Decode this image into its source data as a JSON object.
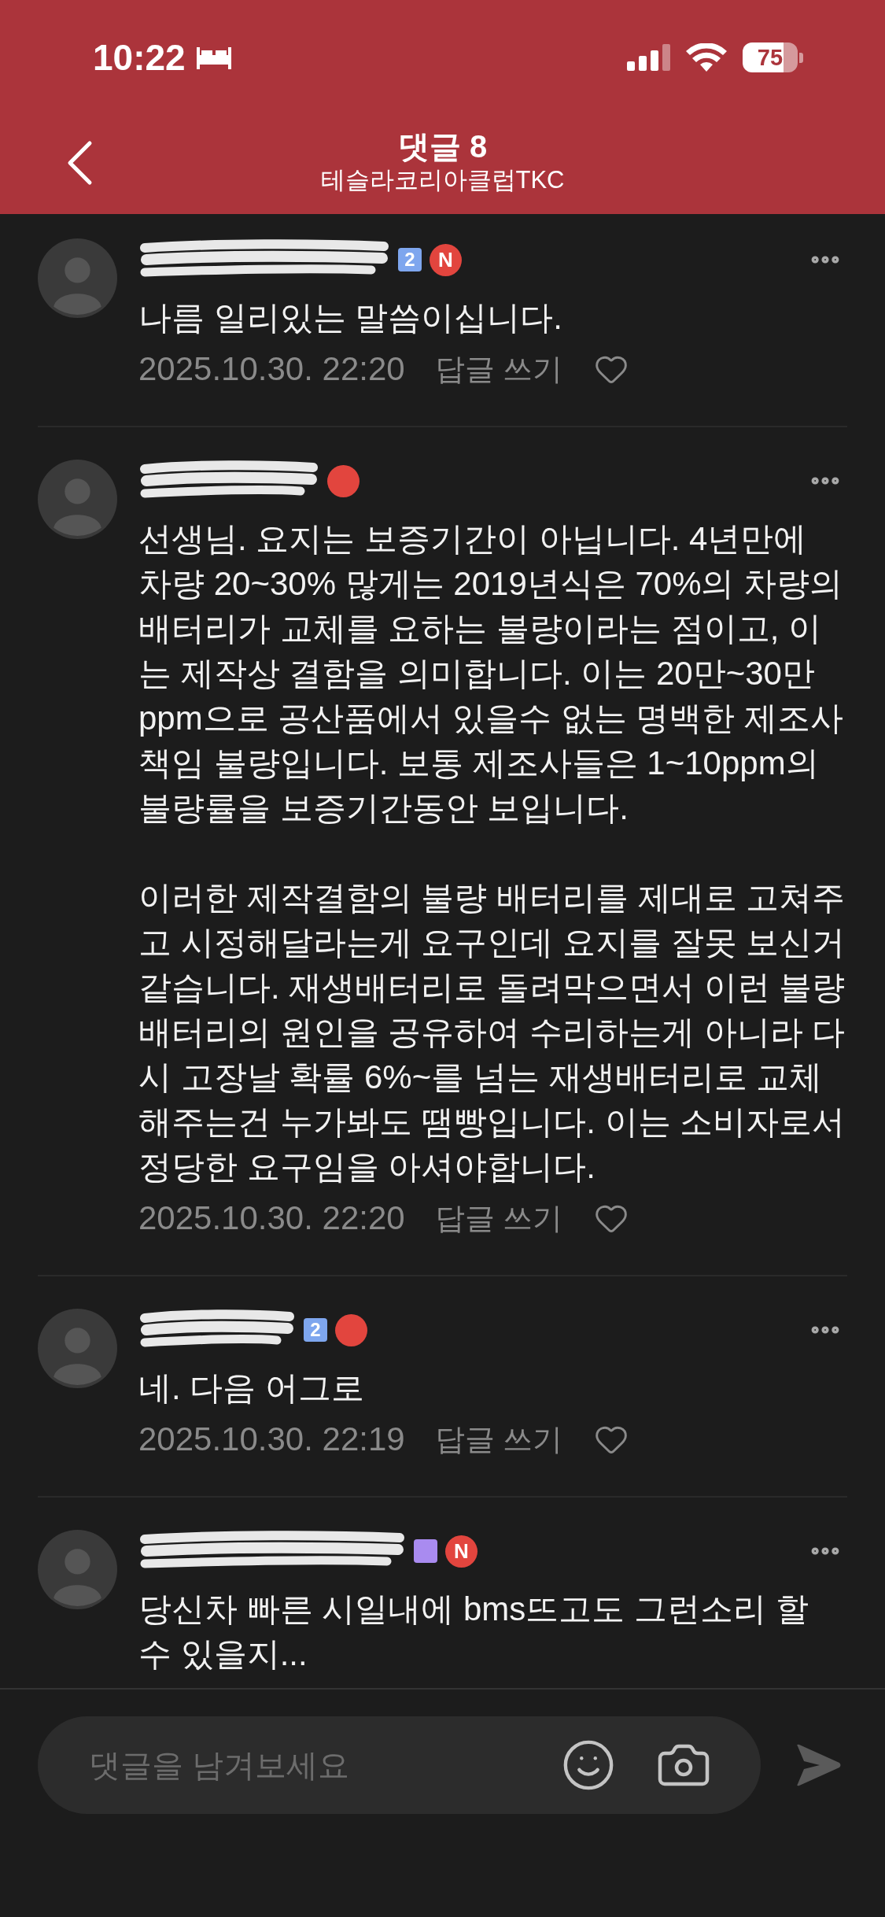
{
  "status_bar": {
    "time": "10:22",
    "battery": "75"
  },
  "header": {
    "title": "댓글 8",
    "subtitle": "테슬라코리아클럽TKC"
  },
  "comments": [
    {
      "badges": [
        {
          "kind": "level",
          "text": "2",
          "color": "#7ea6ee"
        },
        {
          "kind": "new",
          "text": "N"
        }
      ],
      "paragraphs": [
        "나름 일리있는 말씀이십니다."
      ],
      "date": "2025.10.30. 22:20",
      "reply": "답글 쓰기"
    },
    {
      "badges": [
        {
          "kind": "new"
        }
      ],
      "paragraphs": [
        "선생님. 요지는 보증기간이 아닙니다. 4년만에 차량 20~30% 많게는 2019년식은 70%의 차량의 배터리가 교체를 요하는 불량이라는 점이고, 이는 제작상 결함을 의미합니다. 이는 20만~30만ppm으로 공산품에서 있을수 없는 명백한 제조사 책임 불량입니다. 보통 제조사들은 1~10ppm의 불량률을 보증기간동안 보입니다.",
        "이러한 제작결함의 불량 배터리를 제대로 고쳐주고 시정해달라는게 요구인데 요지를 잘못 보신거 같습니다. 재생배터리로 돌려막으면서 이런 불량 배터리의 원인을 공유하여 수리하는게 아니라 다시 고장날 확률 6%~를 넘는 재생배터리로 교체해주는건 누가봐도 땜빵입니다. 이는 소비자로서 정당한 요구임을 아셔야합니다."
      ],
      "date": "2025.10.30. 22:20",
      "reply": "답글 쓰기"
    },
    {
      "badges": [
        {
          "kind": "level",
          "text": "2",
          "color": "#7ea6ee"
        },
        {
          "kind": "new"
        }
      ],
      "paragraphs": [
        "네. 다음 어그로"
      ],
      "date": "2025.10.30. 22:19",
      "reply": "답글 쓰기"
    },
    {
      "badges": [
        {
          "kind": "level",
          "color": "#a98bf0"
        },
        {
          "kind": "new",
          "text": "N"
        }
      ],
      "paragraphs": [
        "당신차 빠른 시일내에 bms뜨고도 그런소리 할 수 있을지..."
      ]
    }
  ],
  "composer": {
    "placeholder": "댓글을 남겨보세요"
  }
}
